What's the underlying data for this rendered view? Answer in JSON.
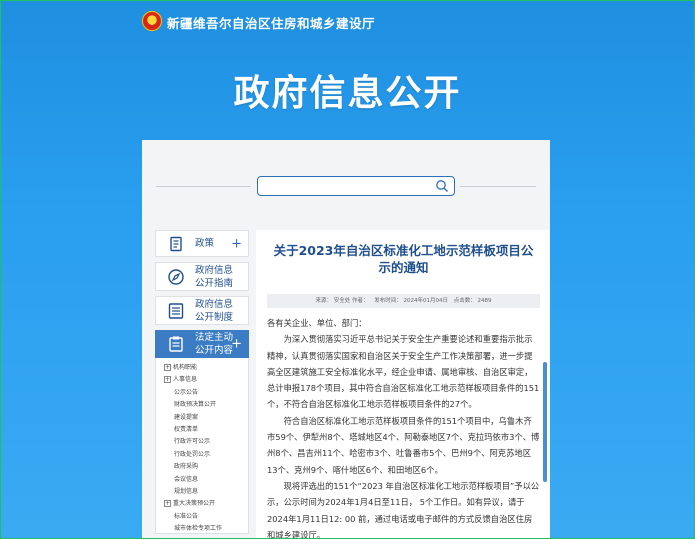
{
  "header": {
    "dept_name": "新疆维吾尔自治区住房和城乡建设厅",
    "hero_title": "政府信息公开"
  },
  "search": {
    "placeholder": ""
  },
  "sidebar": {
    "items": [
      {
        "label": "政策",
        "has_plus": "+"
      },
      {
        "label": "政府信息\n公开指南"
      },
      {
        "label": "政府信息\n公开制度"
      },
      {
        "label": "法定主动\n公开内容",
        "has_plus": "+"
      }
    ],
    "tree": [
      {
        "label": "机构职能",
        "toggle": "⊕",
        "level": 0
      },
      {
        "label": "人事信息",
        "toggle": "⊕",
        "level": 0
      },
      {
        "label": "公示公告",
        "level": 1
      },
      {
        "label": "财政预决算公开",
        "level": 1
      },
      {
        "label": "建设提案",
        "level": 1
      },
      {
        "label": "权责清单",
        "level": 1
      },
      {
        "label": "行政许可公示",
        "level": 1
      },
      {
        "label": "行政处罚公示",
        "level": 1
      },
      {
        "label": "政府采购",
        "level": 1
      },
      {
        "label": "会议信息",
        "level": 1
      },
      {
        "label": "规划信息",
        "level": 1
      },
      {
        "label": "重大决策预公开",
        "toggle": "⊕",
        "level": 0
      },
      {
        "label": "标准公告",
        "level": 1
      },
      {
        "label": "城市体检专项工作",
        "level": 1
      }
    ]
  },
  "article": {
    "title": "关于2023年自治区标准化工地示范样板项目公示的通知",
    "meta": {
      "source": "来源：  安全处 作者：",
      "date": "发布时间：  2024年01月04日",
      "views": "点击数：  2489"
    },
    "paragraphs": [
      "各有关企业、单位、部门：",
      "为深入贯彻落实习近平总书记关于安全生产重要论述和重要指示批示精神，认真贯彻落实国家和自治区关于安全生产工作决策部署，进一步提高全区建筑施工安全标准化水平，经企业申请、属地审核、自治区审定，总计申报178个项目，其中符合自治区标准化工地示范样板项目条件的151个，不符合自治区标准化工地示范样板项目条件的27个。",
      "符合自治区标准化工地示范样板项目条件的151个项目中，乌鲁木齐市59个、伊犁州8个、塔城地区4个、阿勒泰地区7个、克拉玛依市3个、博州8个、昌吉州11个、哈密市3个、吐鲁番市5个、巴州9个、阿克苏地区13个、克州9个、喀什地区6个、和田地区6个。",
      "现将评选出的151个“2023 年自治区标准化工地示范样板项目”予以公示，公示时间为2024年1月4日至11日， 5个工作日。如有异议，请于2024年1月11日12: 00 前，通过电话或电子邮件的方式反馈自治区住房和城乡建设厅。"
    ]
  },
  "colors": {
    "accent": "#3c7cc4",
    "title_blue": "#1f4f8f",
    "bg_blue": "#2a9ff0"
  }
}
